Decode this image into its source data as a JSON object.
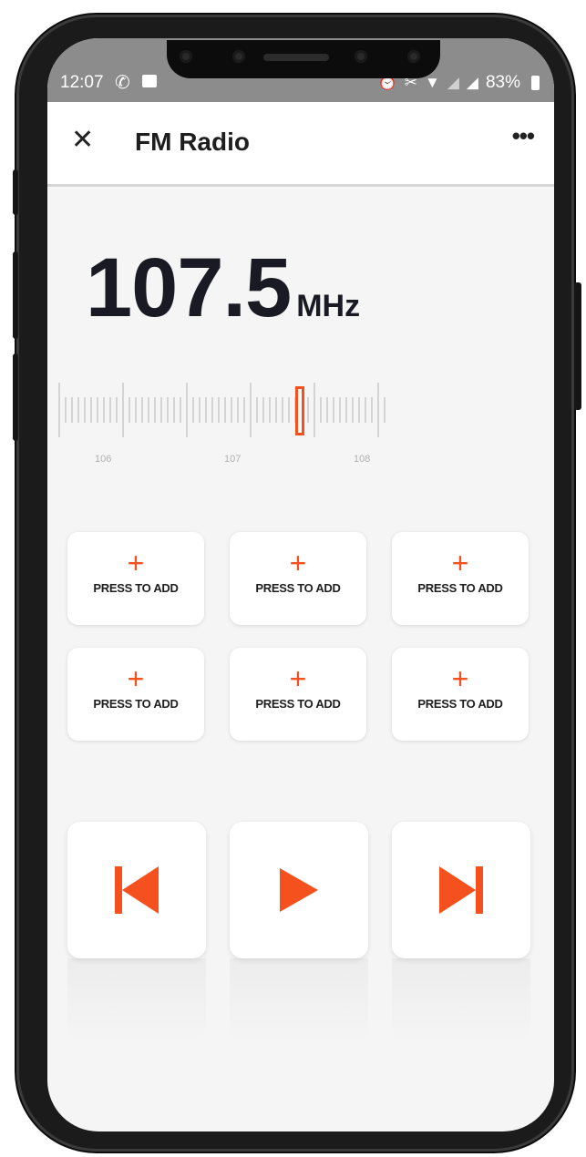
{
  "status_bar": {
    "time": "12:07",
    "battery": "83%",
    "icons": [
      "whatsapp-icon",
      "gallery-icon",
      "alarm-icon",
      "mute-icon",
      "wifi-icon",
      "signal-icon",
      "battery-icon"
    ]
  },
  "app_bar": {
    "title": "FM Radio",
    "close_symbol": "✕",
    "more_symbol": "•••"
  },
  "tuner": {
    "frequency": "107.5",
    "unit": "MHz",
    "scale_labels": [
      "106",
      "107",
      "108"
    ]
  },
  "presets": [
    {
      "symbol": "+",
      "label": "PRESS TO ADD"
    },
    {
      "symbol": "+",
      "label": "PRESS TO ADD"
    },
    {
      "symbol": "+",
      "label": "PRESS TO ADD"
    },
    {
      "symbol": "+",
      "label": "PRESS TO ADD"
    },
    {
      "symbol": "+",
      "label": "PRESS TO ADD"
    },
    {
      "symbol": "+",
      "label": "PRESS TO ADD"
    }
  ],
  "controls": {
    "previous": "skip-previous-icon",
    "play": "play-icon",
    "next": "skip-next-icon"
  },
  "colors": {
    "accent": "#f4511e",
    "status_bar": "#8c8c8c",
    "background": "#f5f5f5"
  }
}
